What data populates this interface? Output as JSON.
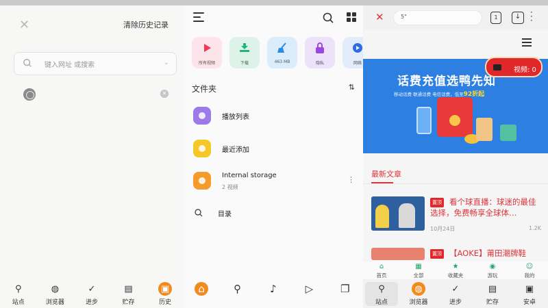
{
  "colors": {
    "accent_orange": "#f28b1e",
    "brand_red": "#e0343b",
    "banner_blue": "#2d7fe1",
    "green": "#1fa66b"
  },
  "history_panel": {
    "clear_label": "清除历史记录",
    "search_placeholder": "键入网址 或搜索",
    "nav": [
      {
        "label": "站点",
        "icon": "search-icon"
      },
      {
        "label": "浏览器",
        "icon": "globe-icon"
      },
      {
        "label": "进步",
        "icon": "check-circle-icon"
      },
      {
        "label": "贮存",
        "icon": "folder-play-icon"
      },
      {
        "label": "历史",
        "icon": "history-icon"
      }
    ]
  },
  "files_panel": {
    "tiles": [
      {
        "label": "所有视频",
        "icon": "play-icon"
      },
      {
        "label": "下载",
        "icon": "download-icon"
      },
      {
        "label": "463 MB",
        "icon": "broom-icon"
      },
      {
        "label": "隐私",
        "icon": "lock-icon"
      },
      {
        "label": "网络",
        "icon": "stream-icon"
      }
    ],
    "section_title": "文件夹",
    "folders": [
      {
        "name": "播放列表",
        "sub": ""
      },
      {
        "name": "最近添加",
        "sub": ""
      },
      {
        "name": "Internal storage",
        "sub": "2 视频"
      }
    ],
    "directory_label": "目录",
    "nav": [
      "home-icon",
      "search-icon",
      "music-icon",
      "play-icon",
      "copy-icon"
    ]
  },
  "browser_panel": {
    "url_text": "5\"",
    "tab_count": "1",
    "video_badge": "视频: 0",
    "banner": {
      "title": "话费充值选鸭先知",
      "subtitle": "移动话费 联通话费 电信话费，低至",
      "discount": "92折起"
    },
    "articles_heading": "最新文章",
    "articles": [
      {
        "tag": "置顶",
        "title": "看个球直播：球迷的最佳选择，免费畅享全球体…",
        "date": "10月24日",
        "views": "1.2K"
      },
      {
        "tag": "置顶",
        "title": "【AOKE】莆田潮牌鞋",
        "date": "",
        "views": ""
      }
    ],
    "site_nav": [
      {
        "label": "首页",
        "icon": "home-icon"
      },
      {
        "label": "全部",
        "icon": "grid-icon"
      },
      {
        "label": "收藏夹",
        "icon": "star-icon"
      },
      {
        "label": "游玩",
        "icon": "gamepad-icon"
      },
      {
        "label": "我的",
        "icon": "user-icon"
      }
    ],
    "nav": [
      {
        "label": "站点",
        "icon": "search-icon"
      },
      {
        "label": "浏览器",
        "icon": "globe-icon"
      },
      {
        "label": "进步",
        "icon": "check-circle-icon"
      },
      {
        "label": "贮存",
        "icon": "folder-play-icon"
      },
      {
        "label": "安卓",
        "icon": "history-icon"
      }
    ]
  }
}
